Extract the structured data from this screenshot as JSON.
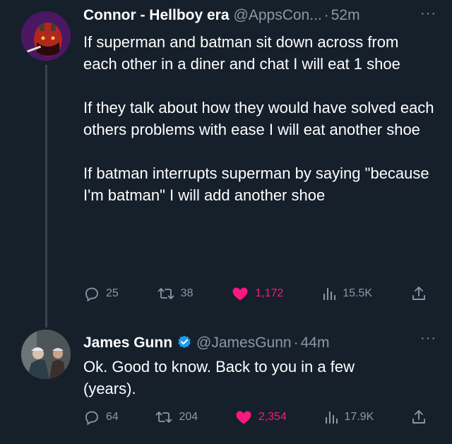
{
  "tweets": [
    {
      "author_name": "Connor - Hellboy era",
      "handle": "@AppsCon...",
      "separator": "·",
      "time": "52m",
      "more": "···",
      "paragraphs": [
        "If superman and batman sit down across from each other in a diner and chat I will eat 1 shoe",
        "If they talk about how they would have solved each others problems with ease I will eat another shoe",
        "If batman interrupts superman by saying \"because I'm batman\" I will add another shoe"
      ],
      "replies": "25",
      "reposts": "38",
      "likes": "1,172",
      "views": "15.5K",
      "liked": true
    },
    {
      "author_name": "James Gunn",
      "verified": true,
      "handle": "@JamesGunn",
      "separator": "·",
      "time": "44m",
      "more": "···",
      "paragraphs": [
        "Ok. Good to know. Back to you in a few (years)."
      ],
      "replies": "64",
      "reposts": "204",
      "likes": "2,354",
      "views": "17.9K",
      "liked": true
    }
  ],
  "colors": {
    "background": "#15202b",
    "secondary_text": "#8b98a5",
    "like_pink": "#f91880",
    "verified_blue": "#1d9bf0"
  },
  "icons": [
    "reply-icon",
    "repost-icon",
    "like-icon",
    "views-icon",
    "share-icon",
    "verified-badge-icon",
    "more-icon"
  ]
}
